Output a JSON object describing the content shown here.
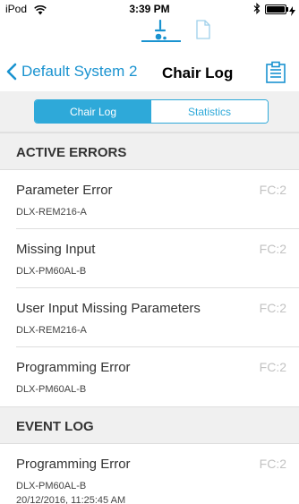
{
  "status_bar": {
    "carrier": "iPod",
    "time": "3:39 PM",
    "wifi_icon": "wifi-icon",
    "bluetooth_icon": "bluetooth-icon",
    "battery_icon": "battery-icon",
    "battery_level": 1.0
  },
  "mode_switch": {
    "items": [
      {
        "icon": "wheelchair-icon",
        "selected": true
      },
      {
        "icon": "document-icon",
        "selected": false
      }
    ]
  },
  "nav": {
    "back_label": "Default System 2",
    "title": "Chair Log",
    "right_icon": "clipboard-icon"
  },
  "tabs": [
    {
      "label": "Chair Log",
      "active": true
    },
    {
      "label": "Statistics",
      "active": false
    }
  ],
  "active_errors": {
    "header": "ACTIVE ERRORS",
    "items": [
      {
        "title": "Parameter Error",
        "code": "FC:2",
        "device": "DLX-REM216-A"
      },
      {
        "title": "Missing Input",
        "code": "FC:2",
        "device": "DLX-PM60AL-B"
      },
      {
        "title": "User Input Missing Parameters",
        "code": "FC:2",
        "device": "DLX-REM216-A"
      },
      {
        "title": "Programming Error",
        "code": "FC:2",
        "device": "DLX-PM60AL-B"
      }
    ]
  },
  "event_log": {
    "header": "EVENT LOG",
    "items": [
      {
        "title": "Programming Error",
        "code": "FC:2",
        "device": "DLX-PM60AL-B",
        "timestamp": "20/12/2016, 11:25:45 AM"
      }
    ]
  },
  "colors": {
    "accent": "#1a93d0",
    "segment_accent": "#2ea9d9",
    "section_bg": "#f0f0f0",
    "code_text": "#c2c2c2"
  }
}
